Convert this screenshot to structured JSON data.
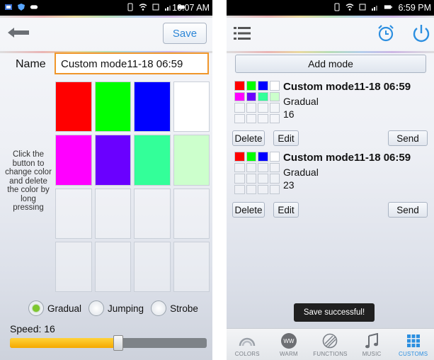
{
  "left_screen": {
    "status": {
      "time": "10:07 AM"
    },
    "toolbar": {
      "save_label": "Save"
    },
    "name": {
      "label": "Name",
      "value": "Custom mode11-18 06:59"
    },
    "color_grid": {
      "cells": [
        "#ff0000",
        "#00ff00",
        "#0000ff",
        "#ffffff",
        "#ff00ff",
        "#6a00ff",
        "#33ff99",
        "#ccffcc",
        "",
        "",
        "",
        "",
        "",
        "",
        "",
        ""
      ]
    },
    "hint": "Click the button to change color and delete the color by long pressing",
    "modes": {
      "options": [
        "Gradual",
        "Jumping",
        "Strobe"
      ],
      "selected": "Gradual"
    },
    "speed": {
      "label": "Speed: 16",
      "value": 16,
      "max": 100,
      "fraction": 0.55
    }
  },
  "right_screen": {
    "status": {
      "time": "6:59 PM"
    },
    "add_mode_label": "Add mode",
    "modes": [
      {
        "title": "Custom mode11-18 06:59",
        "type": "Gradual",
        "speed": "16",
        "colors": [
          "#ff0000",
          "#00ff00",
          "#0000ff",
          "#ffffff",
          "#ff00ff",
          "#6a00ff",
          "#33ff99",
          "#ccffcc",
          "",
          "",
          "",
          "",
          "",
          "",
          "",
          ""
        ],
        "delete_label": "Delete",
        "edit_label": "Edit",
        "send_label": "Send"
      },
      {
        "title": "Custom mode11-18 06:59",
        "type": "Gradual",
        "speed": "23",
        "colors": [
          "#ff0000",
          "#00ff00",
          "#0000ff",
          "#ffffff",
          "",
          "",
          "",
          "",
          "",
          "",
          "",
          "",
          "",
          "",
          "",
          ""
        ],
        "delete_label": "Delete",
        "edit_label": "Edit",
        "send_label": "Send"
      }
    ],
    "toast": "Save successful!",
    "tabs": [
      {
        "label": "COLORS",
        "icon": "rainbow-icon",
        "active": false
      },
      {
        "label": "WARM",
        "icon": "ww-icon",
        "active": false
      },
      {
        "label": "FUNCTIONS",
        "icon": "functions-icon",
        "active": false
      },
      {
        "label": "MUSIC",
        "icon": "music-note-icon",
        "active": false
      },
      {
        "label": "CUSTOMS",
        "icon": "customs-grid-icon",
        "active": true
      }
    ],
    "ww_text": "WW"
  },
  "colors": {
    "accent": "#2c86d6",
    "input_border": "#f0962a",
    "slider_fill": "#f5a800",
    "radio_selected": "#7dc72d"
  }
}
